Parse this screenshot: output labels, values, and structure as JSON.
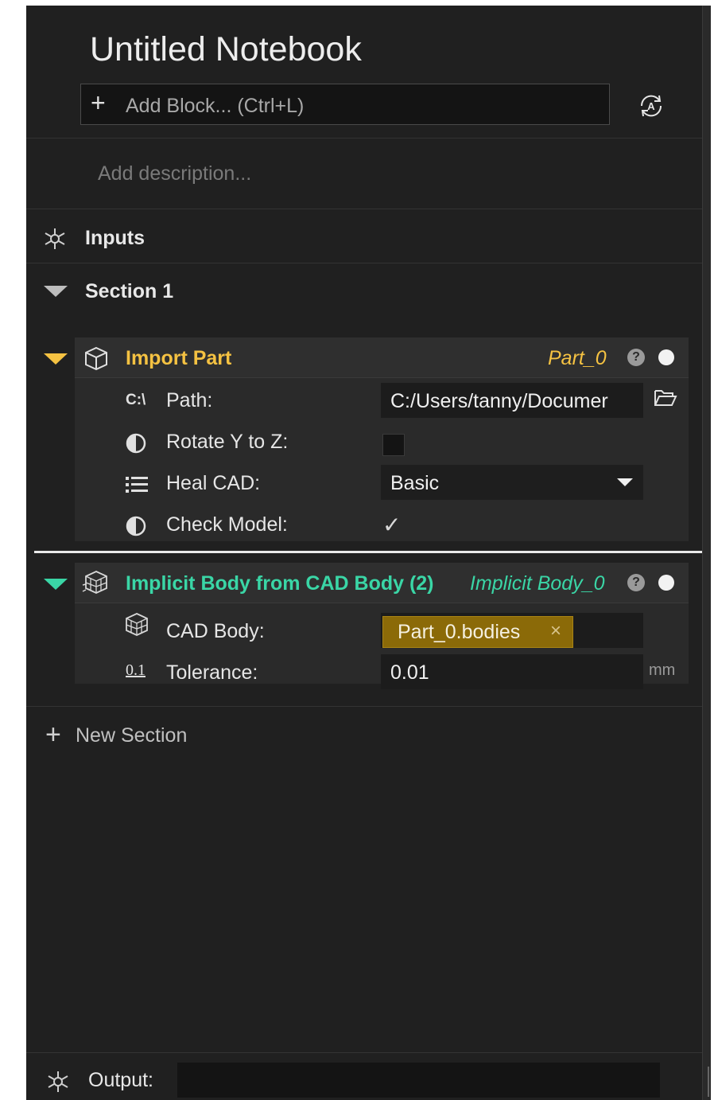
{
  "notebook": {
    "title": "Untitled Notebook",
    "add_block_placeholder": "Add Block... (Ctrl+L)",
    "description_placeholder": "Add description...",
    "auto_icon": "auto-run-icon"
  },
  "inputs": {
    "label": "Inputs",
    "icon": "inputs-node-icon"
  },
  "section": {
    "label": "Section 1",
    "expanded": true
  },
  "blocks": [
    {
      "title": "Import Part",
      "output_name": "Part_0",
      "accent_color": "#f5c242",
      "icon": "part-cube-icon",
      "rows": [
        {
          "icon": "path-icon",
          "icon_text": "C:\\",
          "label": "Path:",
          "value": "C:/Users/tanny/Documer",
          "action_icon": "folder-open-icon"
        },
        {
          "icon": "half-circle-icon",
          "label": "Rotate Y to Z:",
          "checked": false
        },
        {
          "icon": "list-icon",
          "label": "Heal CAD:",
          "value": "Basic",
          "dropdown_icon": "chevron-down-icon"
        },
        {
          "icon": "half-circle-icon",
          "label": "Check Model:",
          "checked": true,
          "check_mark": "✓"
        }
      ]
    },
    {
      "title": "Implicit Body from CAD Body (2)",
      "output_name": "Implicit Body_0",
      "accent_color": "#3ad6a6",
      "icon": "implicit-body-icon",
      "rows": [
        {
          "icon": "cad-body-icon",
          "label": "CAD Body:",
          "chip": "Part_0.bodies",
          "chip_remove": "×"
        },
        {
          "icon": "number-icon",
          "icon_text": "0.1",
          "label": "Tolerance:",
          "value": "0.01",
          "unit": "mm"
        }
      ]
    }
  ],
  "help_glyph": "?",
  "new_section": "New Section",
  "output": {
    "label": "Output:",
    "value": ""
  },
  "colors": {
    "background": "#202020",
    "header": "#2f2f2f",
    "field": "#1c1c1c",
    "chip": "#8b6a08"
  }
}
